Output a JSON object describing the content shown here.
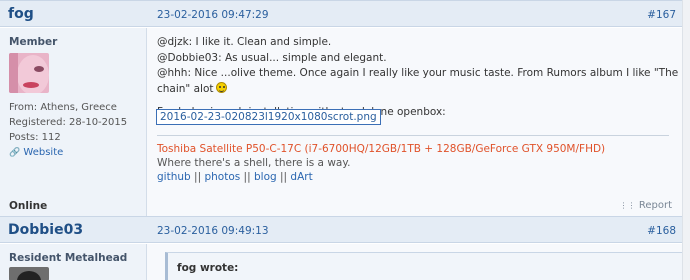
{
  "post1": {
    "author": "fog",
    "date": "23-02-2016 09:47:29",
    "number": "#167",
    "rank": "Member",
    "info": [
      "From: Athens, Greece",
      "Registered: 28-10-2015",
      "Posts: 112"
    ],
    "website_label": "Website",
    "status": "Online",
    "body": {
      "line1": "@djzk: I like it. Clean and simple.",
      "line2_mention": "@Dobbie03",
      "line2_rest": ": As usual... simple and elegant.",
      "line3": "@hhh: Nice ...olive theme. Once again I really like your music taste. From Rumors album I like \"The chain\" alot",
      "line4": "Fresh, basic arch installation with standalone openbox:",
      "attachment": "2016-02-23-020823l1920x1080scrot.png"
    },
    "signature": {
      "line1": "Toshiba Satellite P50-C-17C (i7-6700HQ/12GB/1TB + 128GB/GeForce GTX 950M/FHD)",
      "line2": "Where there's a shell, there is a way.",
      "links": [
        "github",
        "photos",
        "blog",
        "dArt"
      ],
      "sep": " || "
    },
    "report_label": "Report"
  },
  "post2": {
    "author": "Dobbie03",
    "date": "23-02-2016 09:49:13",
    "number": "#168",
    "rank": "Resident Metalhead",
    "quote_label": "fog wrote:"
  }
}
